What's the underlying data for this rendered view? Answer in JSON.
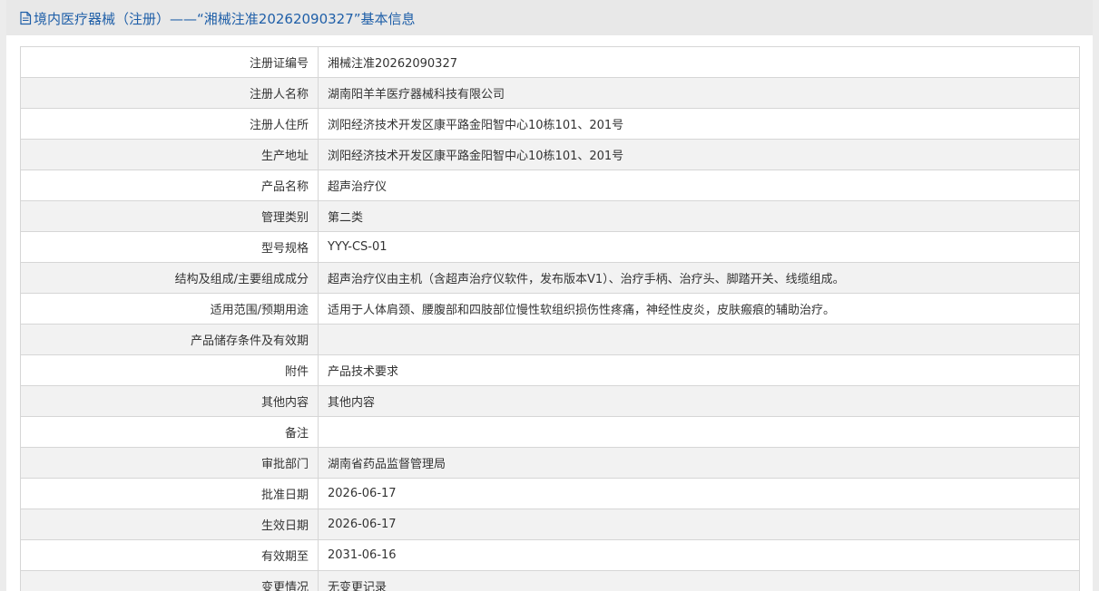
{
  "header": {
    "title": "境内医疗器械（注册）——“湘械注准20262090327”基本信息",
    "icon": "document-icon"
  },
  "rows": [
    {
      "label": "注册证编号",
      "value": "湘械注准20262090327"
    },
    {
      "label": "注册人名称",
      "value": "湖南阳羊羊医疗器械科技有限公司"
    },
    {
      "label": "注册人住所",
      "value": "浏阳经济技术开发区康平路金阳智中心10栋101、201号"
    },
    {
      "label": "生产地址",
      "value": "浏阳经济技术开发区康平路金阳智中心10栋101、201号"
    },
    {
      "label": "产品名称",
      "value": "超声治疗仪"
    },
    {
      "label": "管理类别",
      "value": "第二类"
    },
    {
      "label": "型号规格",
      "value": "YYY-CS-01"
    },
    {
      "label": "结构及组成/主要组成成分",
      "value": "超声治疗仪由主机（含超声治疗仪软件，发布版本V1）、治疗手柄、治疗头、脚踏开关、线缆组成。"
    },
    {
      "label": "适用范围/预期用途",
      "value": "适用于人体肩颈、腰腹部和四肢部位慢性软组织损伤性疼痛，神经性皮炎，皮肤瘢痕的辅助治疗。"
    },
    {
      "label": "产品储存条件及有效期",
      "value": ""
    },
    {
      "label": "附件",
      "value": "产品技术要求"
    },
    {
      "label": "其他内容",
      "value": "其他内容"
    },
    {
      "label": "备注",
      "value": ""
    },
    {
      "label": "审批部门",
      "value": "湖南省药品监督管理局"
    },
    {
      "label": "批准日期",
      "value": "2026-06-17"
    },
    {
      "label": "生效日期",
      "value": "2026-06-17"
    },
    {
      "label": "有效期至",
      "value": "2031-06-16"
    },
    {
      "label": "变更情况",
      "value": "无变更记录"
    }
  ],
  "colors": {
    "title": "#1f5fa8",
    "header_bg": "#e8e8e8",
    "row_alt": "#f2f2f2",
    "border": "#d6d6d6"
  }
}
